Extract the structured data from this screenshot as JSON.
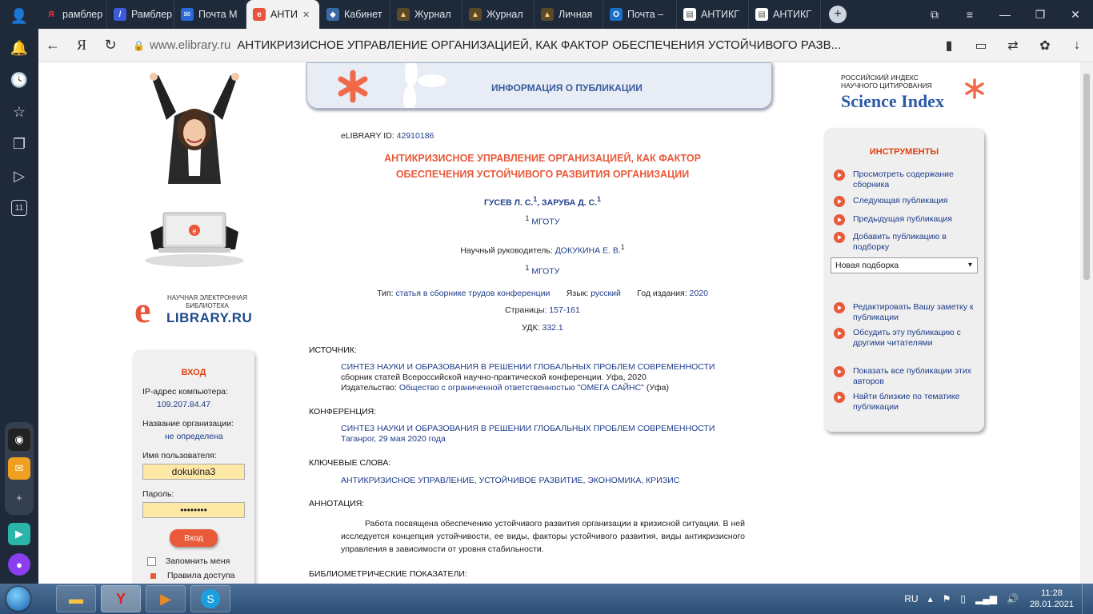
{
  "browser": {
    "tabs": [
      {
        "label": "рамблер",
        "icon": "Я",
        "icon_bg": "#1e2a3a",
        "icon_color": "#ff3333"
      },
      {
        "label": "Рамблер",
        "icon": "/",
        "icon_bg": "#3b5bdb",
        "icon_color": "#ffffff"
      },
      {
        "label": "Почта М",
        "icon": "✉",
        "icon_bg": "#2a6ad8",
        "icon_color": "#ffffff"
      },
      {
        "label": "АНТИ",
        "icon": "e",
        "icon_bg": "#e8553a",
        "icon_color": "#ffffff",
        "active": true
      },
      {
        "label": "Кабинет",
        "icon": "◆",
        "icon_bg": "#3a6aa8",
        "icon_color": "#ffffff"
      },
      {
        "label": "Журнал",
        "icon": "▲",
        "icon_bg": "#5a4a2a",
        "icon_color": "#ffd27a"
      },
      {
        "label": "Журнал",
        "icon": "▲",
        "icon_bg": "#5a4a2a",
        "icon_color": "#ffd27a"
      },
      {
        "label": "Личная",
        "icon": "▲",
        "icon_bg": "#5a4a2a",
        "icon_color": "#ffd27a"
      },
      {
        "label": "Почта –",
        "icon": "O",
        "icon_bg": "#1a6fc8",
        "icon_color": "#ffffff"
      },
      {
        "label": "АНТИКГ",
        "icon": "▤",
        "icon_bg": "#ffffff",
        "icon_color": "#555555"
      },
      {
        "label": "АНТИКГ",
        "icon": "▤",
        "icon_bg": "#ffffff",
        "icon_color": "#555555"
      }
    ],
    "url_domain": "www.elibrary.ru",
    "page_title": "АНТИКРИЗИСНОЕ УПРАВЛЕНИЕ ОРГАНИЗАЦИЕЙ, КАК ФАКТОР ОБЕСПЕЧЕНИЯ УСТОЙЧИВОГО РАЗВ..."
  },
  "sidebar": {
    "badge": "11"
  },
  "header": {
    "title": "ИНФОРМАЦИЯ О ПУБЛИКАЦИИ"
  },
  "logo": {
    "line1": "НАУЧНАЯ ЭЛЕКТРОННАЯ",
    "line2": "БИБЛИОТЕКА",
    "name": "LIBRARY.RU",
    "letter": "e"
  },
  "login": {
    "title": "ВХОД",
    "ip_label": "IP-адрес компьютера:",
    "ip_value": "109.207.84.47",
    "org_label": "Название организации:",
    "org_value": "не определена",
    "user_label": "Имя пользователя:",
    "user_value": "dokukina3",
    "pass_label": "Пароль:",
    "pass_value": "••••••••",
    "button": "Вход",
    "remember": "Запомнить меня",
    "rules": "Правила доступа"
  },
  "pub": {
    "id_label": "eLIBRARY ID:",
    "id_value": "42910186",
    "title_line1": "АНТИКРИЗИСНОЕ УПРАВЛЕНИЕ ОРГАНИЗАЦИЕЙ, КАК ФАКТОР",
    "title_line2": "ОБЕСПЕЧЕНИЯ УСТОЙЧИВОГО РАЗВИТИЯ ОРГАНИЗАЦИИ",
    "author1": "ГУСЕВ Л. С.",
    "author2": "ЗАРУБА Д. С.",
    "sup": "1",
    "affil": "МГОТУ",
    "supervisor_label": "Научный руководитель:",
    "supervisor": "ДОКУКИНА Е. В.",
    "type_label": "Тип:",
    "type_value": "статья в сборнике трудов конференции",
    "lang_label": "Язык:",
    "lang_value": "русский",
    "year_label": "Год издания:",
    "year_value": "2020",
    "pages_label": "Страницы:",
    "pages_value": "157-161",
    "udk_label": "УДК:",
    "udk_value": "332.1",
    "source_h": "ИСТОЧНИК:",
    "source_title": "СИНТЕЗ НАУКИ И ОБРАЗОВАНИЯ В РЕШЕНИИ ГЛОБАЛЬНЫХ ПРОБЛЕМ СОВРЕМЕННОСТИ",
    "source_desc": "сборник статей Всероссийской научно-практической конференции. Уфа, 2020",
    "publisher_label": "Издательство:",
    "publisher_value": "Общество с ограниченной ответственностью \"ОМЕГА САЙНС\"",
    "publisher_city": "(Уфа)",
    "conf_h": "КОНФЕРЕНЦИЯ:",
    "conf_title": "СИНТЕЗ НАУКИ И ОБРАЗОВАНИЯ В РЕШЕНИИ ГЛОБАЛЬНЫХ ПРОБЛЕМ СОВРЕМЕННОСТИ",
    "conf_place": "Таганрог, 29 мая 2020 года",
    "kw_h": "КЛЮЧЕВЫЕ СЛОВА:",
    "kw_value": "АНТИКРИЗИСНОЕ УПРАВЛЕНИЕ, УСТОЙЧИВОЕ РАЗВИТИЕ, ЭКОНОМИКА, КРИЗИС",
    "abs_h": "АННОТАЦИЯ:",
    "abs_text": "Работа посвящена обеспечению устойчивого развития организации в кризисной ситуации. В ней исследуется концепция устойчивости, ее виды, факторы устойчивого развития, виды антикризисного управления в зависимости от уровня стабильности.",
    "biblio_h": "БИБЛИОМЕТРИЧЕСКИЕ ПОКАЗАТЕЛИ:"
  },
  "science_index": {
    "line1": "РОССИЙСКИЙ ИНДЕКС",
    "line2": "НАУЧНОГО ЦИТИРОВАНИЯ",
    "name": "Science Index"
  },
  "tools": {
    "title": "ИНСТРУМЕНТЫ",
    "items": [
      "Просмотреть содержание сборника",
      "Следующая публикация",
      "Предыдущая публикация",
      "Добавить публикацию в подборку",
      "Редактировать Вашу заметку к публикации",
      "Обсудить эту публикацию с другими читателями",
      "Показать все публикации этих авторов",
      "Найти близкие по тематике публикации"
    ],
    "select_value": "Новая подборка"
  },
  "taskbar": {
    "lang": "RU",
    "time": "11:28",
    "date": "28.01.2021"
  },
  "colors": {
    "accent": "#e85a3a",
    "link": "#1e3c8a"
  }
}
